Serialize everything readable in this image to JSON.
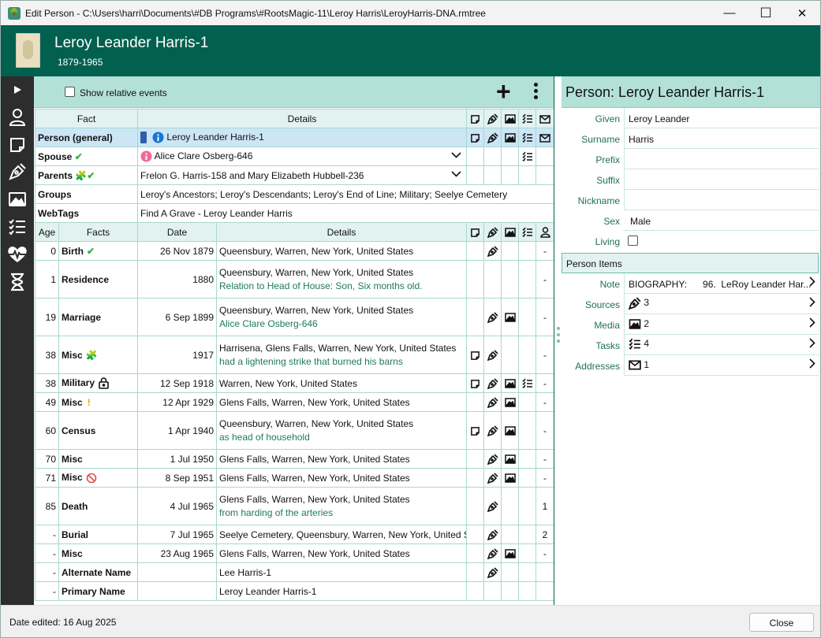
{
  "window": {
    "title": "Edit Person - C:\\Users\\harri\\Documents\\#DB Programs\\#RootsMagic-11\\Leroy Harris\\LeroyHarris-DNA.rmtree",
    "minimize": "—",
    "maximize": "☐",
    "close": "✕"
  },
  "header": {
    "name": "Leroy Leander Harris-1",
    "dates": "1879-1965"
  },
  "sidebar": {
    "icons": [
      "expand-arrow-icon",
      "person-icon",
      "note-icon",
      "citation-pen-icon",
      "media-icon",
      "task-list-icon",
      "health-heart-icon",
      "hourglass-icon"
    ]
  },
  "toolbar": {
    "show_relative_events": "Show relative events",
    "add": "+"
  },
  "facts_table": {
    "headers": {
      "fact": "Fact",
      "details": "Details"
    },
    "rows": {
      "person": {
        "label": "Person (general)",
        "detail": "Leroy Leander Harris-1"
      },
      "spouse": {
        "label": "Spouse",
        "detail": "Alice Clare Osberg-646"
      },
      "parents": {
        "label": "Parents",
        "detail": "Frelon G. Harris-158 and Mary Elizabeth Hubbell-236"
      },
      "groups": {
        "label": "Groups",
        "detail": "Leroy's Ancestors; Leroy's Descendants; Leroy's End of Line; Military; Seelye Cemetery"
      },
      "webtags": {
        "label": "WebTags",
        "detail": "Find A Grave - Leroy Leander Harris"
      }
    }
  },
  "events_table": {
    "headers": {
      "age": "Age",
      "facts": "Facts",
      "date": "Date",
      "details": "Details"
    },
    "rows": [
      {
        "age": "0",
        "fact": "Birth",
        "date": "26 Nov 1879",
        "place": "Queensbury, Warren, New York, United States",
        "desc": "",
        "count": "-"
      },
      {
        "age": "1",
        "fact": "Residence",
        "date": "1880",
        "place": "Queensbury, Warren, New York, United States",
        "desc": "Relation to Head of House: Son, Six months old.",
        "count": "-"
      },
      {
        "age": "19",
        "fact": "Marriage",
        "date": "6 Sep 1899",
        "place": "Queensbury, Warren, New York, United States",
        "desc": "Alice Clare Osberg-646",
        "count": "-"
      },
      {
        "age": "38",
        "fact": "Misc",
        "date": "1917",
        "place": "Harrisena, Glens Falls, Warren, New York, United States",
        "desc": "had a  lightening strike that burned his barns",
        "count": "-"
      },
      {
        "age": "38",
        "fact": "Military",
        "date": "12 Sep 1918",
        "place": "Warren, New York, United States",
        "desc": "",
        "count": "-"
      },
      {
        "age": "49",
        "fact": "Misc",
        "date": "12 Apr 1929",
        "place": "Glens Falls, Warren, New York, United States",
        "desc": "",
        "count": "-"
      },
      {
        "age": "60",
        "fact": "Census",
        "date": "1 Apr 1940",
        "place": "Queensbury, Warren, New York, United States",
        "desc": "as head of household",
        "count": "-"
      },
      {
        "age": "70",
        "fact": "Misc",
        "date": "1 Jul 1950",
        "place": "Glens Falls, Warren, New York, United States",
        "desc": "",
        "count": "-"
      },
      {
        "age": "71",
        "fact": "Misc",
        "date": "8 Sep 1951",
        "place": "Glens Falls, Warren, New York, United States",
        "desc": "",
        "count": "-"
      },
      {
        "age": "85",
        "fact": "Death",
        "date": "4 Jul 1965",
        "place": "Glens Falls, Warren, New York, United States",
        "desc": "from harding of the arteries",
        "count": "1"
      },
      {
        "age": "-",
        "fact": "Burial",
        "date": "7 Jul 1965",
        "place": "Seelye Cemetery, Queensbury, Warren, New York, United States",
        "desc": "",
        "count": "2"
      },
      {
        "age": "-",
        "fact": "Misc",
        "date": "23 Aug 1965",
        "place": "Glens Falls, Warren, New York, United States",
        "desc": "",
        "count": "-"
      },
      {
        "age": "-",
        "fact": "Alternate Name",
        "date": "",
        "place": "Lee Harris-1",
        "desc": "",
        "count": ""
      },
      {
        "age": "-",
        "fact": "Primary Name",
        "date": "",
        "place": "Leroy Leander Harris-1",
        "desc": "",
        "count": ""
      }
    ]
  },
  "right_panel": {
    "title": "Person: Leroy Leander Harris-1",
    "fields": {
      "given": {
        "label": "Given",
        "value": "Leroy Leander"
      },
      "surname": {
        "label": "Surname",
        "value": "Harris"
      },
      "prefix": {
        "label": "Prefix",
        "value": ""
      },
      "suffix": {
        "label": "Suffix",
        "value": ""
      },
      "nickname": {
        "label": "Nickname",
        "value": ""
      },
      "sex": {
        "label": "Sex",
        "value": "Male"
      },
      "living": {
        "label": "Living",
        "value": ""
      }
    },
    "person_items_header": "Person Items",
    "items": {
      "note": {
        "label": "Note",
        "value": "BIOGRAPHY:      96.  LeRoy Leander Har..."
      },
      "sources": {
        "label": "Sources",
        "value": "3"
      },
      "media": {
        "label": "Media",
        "value": "2"
      },
      "tasks": {
        "label": "Tasks",
        "value": "4"
      },
      "addresses": {
        "label": "Addresses",
        "value": "1"
      }
    }
  },
  "status": {
    "date_edited": "Date edited: 16 Aug 2025",
    "close_button": "Close"
  },
  "colors": {
    "header_bg": "#02604f",
    "toolbar_bg": "#b3e1d8",
    "selected_row": "#cce6f6",
    "check_green": "#3cb043",
    "puzzle_blue": "#1976d2"
  }
}
